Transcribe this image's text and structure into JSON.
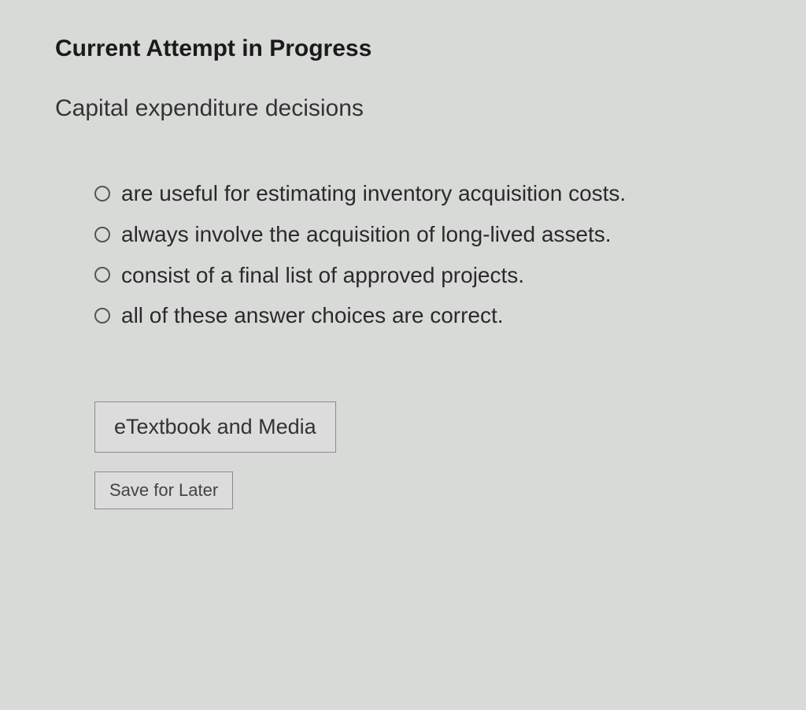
{
  "heading": "Current Attempt in Progress",
  "question": "Capital expenditure decisions",
  "options": [
    {
      "label": "are useful for estimating inventory acquisition costs."
    },
    {
      "label": "always involve the acquisition of long-lived assets."
    },
    {
      "label": "consist of a final list of approved projects."
    },
    {
      "label": "all of these answer choices are correct."
    }
  ],
  "buttons": {
    "etextbook": "eTextbook and Media",
    "save": "Save for Later"
  }
}
